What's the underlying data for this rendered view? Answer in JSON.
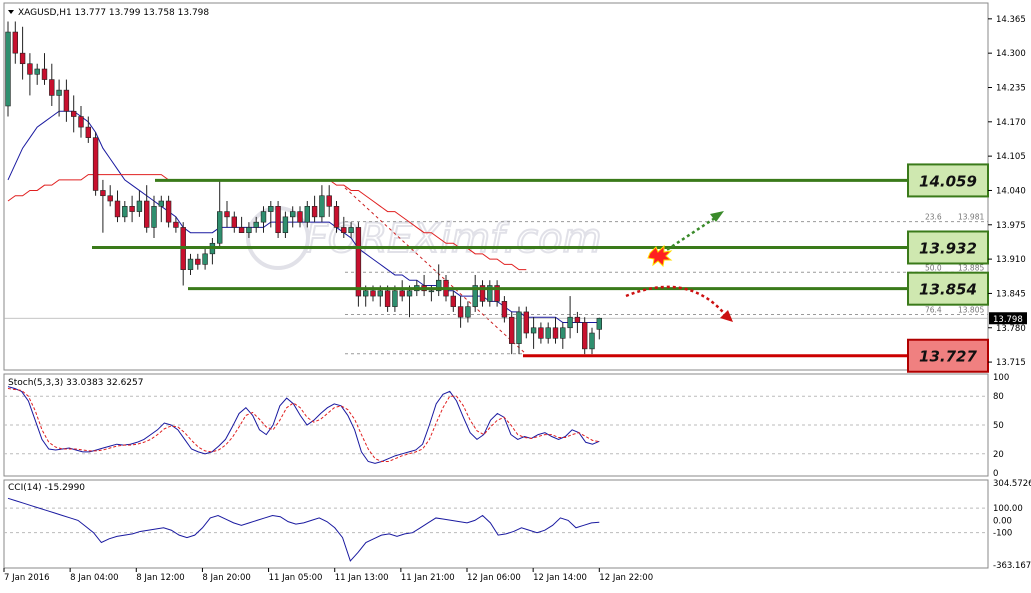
{
  "main": {
    "title": "XAGUSD,H1  13.777 13.799 13.758 13.798",
    "price_ticks": [
      "14.365",
      "14.300",
      "14.235",
      "14.170",
      "14.105",
      "14.040",
      "13.975",
      "13.910",
      "13.845",
      "13.780",
      "13.715"
    ],
    "current_price": "13.798",
    "fib_labels": [
      {
        "value": 13.981,
        "left": "23.6",
        "right": "13.981"
      },
      {
        "value": 13.885,
        "left": "50.0",
        "right": "13.885"
      },
      {
        "value": 13.805,
        "left": "76.4",
        "right": "13.805"
      }
    ],
    "levels": [
      {
        "value": 14.059,
        "label": "14.059",
        "kind": "resistance"
      },
      {
        "value": 13.932,
        "label": "13.932",
        "kind": "resistance"
      },
      {
        "value": 13.854,
        "label": "13.854",
        "kind": "resistance"
      },
      {
        "value": 13.727,
        "label": "13.727",
        "kind": "support"
      }
    ],
    "watermark": "FOREXimf.com"
  },
  "stoch": {
    "title": "Stoch(5,3,3) 33.0383 32.6257",
    "ticks": [
      "100",
      "80",
      "50",
      "20",
      "0"
    ]
  },
  "cci": {
    "title": "CCI(14) -15.2990",
    "ticks": [
      "304.5726",
      "100.00",
      "0.00",
      "-100",
      "-363.167"
    ]
  },
  "time_labels": [
    "7 Jan 2016",
    "8 Jan 04:00",
    "8 Jan 12:00",
    "8 Jan 20:00",
    "11 Jan 05:00",
    "11 Jan 13:00",
    "11 Jan 21:00",
    "12 Jan 06:00",
    "12 Jan 14:00",
    "12 Jan 22:00"
  ],
  "colors": {
    "up_candle": "#2f8f6f",
    "down_candle": "#c8102e",
    "ma_fast": "#1a1aa0",
    "ma_slow": "#e02020",
    "level_line": "#3a7a1a",
    "support_line": "#cc0000",
    "level_box_bg": "#cfe8b0",
    "support_box_bg": "#f08080"
  },
  "chart_data": [
    {
      "type": "candlestick",
      "title": "XAGUSD,H1  13.777 13.799 13.758 13.798",
      "ylim": [
        13.7,
        14.395
      ],
      "candles": [
        [
          14.2,
          14.36,
          14.18,
          14.34
        ],
        [
          14.34,
          14.36,
          14.28,
          14.3
        ],
        [
          14.3,
          14.35,
          14.25,
          14.28
        ],
        [
          14.28,
          14.3,
          14.22,
          14.26
        ],
        [
          14.26,
          14.28,
          14.24,
          14.27
        ],
        [
          14.27,
          14.3,
          14.24,
          14.25
        ],
        [
          14.25,
          14.28,
          14.2,
          14.22
        ],
        [
          14.22,
          14.25,
          14.18,
          14.23
        ],
        [
          14.23,
          14.25,
          14.17,
          14.19
        ],
        [
          14.19,
          14.22,
          14.15,
          14.18
        ],
        [
          14.18,
          14.2,
          14.14,
          14.16
        ],
        [
          14.16,
          14.18,
          14.13,
          14.14
        ],
        [
          14.14,
          14.15,
          14.03,
          14.04
        ],
        [
          14.04,
          14.06,
          13.96,
          14.03
        ],
        [
          14.03,
          14.05,
          14.01,
          14.02
        ],
        [
          14.02,
          14.04,
          13.98,
          13.99
        ],
        [
          13.99,
          14.02,
          13.98,
          14.01
        ],
        [
          14.01,
          14.03,
          13.98,
          14.0
        ],
        [
          14.0,
          14.04,
          13.99,
          14.02
        ],
        [
          14.02,
          14.05,
          13.96,
          13.97
        ],
        [
          13.97,
          14.03,
          13.95,
          14.01
        ],
        [
          14.01,
          14.03,
          13.98,
          14.02
        ],
        [
          14.02,
          14.03,
          13.97,
          13.98
        ],
        [
          13.98,
          13.99,
          13.96,
          13.97
        ],
        [
          13.97,
          13.98,
          13.86,
          13.89
        ],
        [
          13.89,
          13.92,
          13.88,
          13.91
        ],
        [
          13.91,
          13.92,
          13.89,
          13.9
        ],
        [
          13.9,
          13.93,
          13.89,
          13.92
        ],
        [
          13.92,
          13.95,
          13.9,
          13.94
        ],
        [
          13.94,
          14.06,
          13.93,
          14.0
        ],
        [
          14.0,
          14.02,
          13.97,
          13.99
        ],
        [
          13.99,
          14.0,
          13.96,
          13.97
        ],
        [
          13.97,
          13.99,
          13.96,
          13.96
        ],
        [
          13.96,
          13.98,
          13.95,
          13.97
        ],
        [
          13.97,
          13.99,
          13.96,
          13.98
        ],
        [
          13.98,
          14.01,
          13.96,
          14.0
        ],
        [
          14.0,
          14.02,
          13.97,
          14.01
        ],
        [
          14.01,
          14.02,
          13.95,
          13.96
        ],
        [
          13.96,
          14.0,
          13.95,
          13.99
        ],
        [
          13.99,
          14.01,
          13.97,
          14.0
        ],
        [
          14.0,
          14.01,
          13.97,
          13.98
        ],
        [
          13.98,
          14.02,
          13.97,
          14.01
        ],
        [
          14.01,
          14.03,
          13.98,
          13.99
        ],
        [
          13.99,
          14.05,
          13.98,
          14.03
        ],
        [
          14.03,
          14.05,
          13.99,
          14.01
        ],
        [
          14.01,
          14.02,
          13.96,
          13.97
        ],
        [
          13.97,
          13.99,
          13.95,
          13.96
        ],
        [
          13.96,
          13.98,
          13.95,
          13.97
        ],
        [
          13.97,
          13.98,
          13.82,
          13.84
        ],
        [
          13.84,
          13.86,
          13.82,
          13.85
        ],
        [
          13.85,
          13.86,
          13.83,
          13.84
        ],
        [
          13.84,
          13.86,
          13.82,
          13.85
        ],
        [
          13.85,
          13.86,
          13.81,
          13.82
        ],
        [
          13.82,
          13.86,
          13.81,
          13.85
        ],
        [
          13.85,
          13.87,
          13.83,
          13.84
        ],
        [
          13.84,
          13.86,
          13.8,
          13.85
        ],
        [
          13.85,
          13.87,
          13.84,
          13.86
        ],
        [
          13.86,
          13.88,
          13.84,
          13.85
        ],
        [
          13.85,
          13.86,
          13.83,
          13.85
        ],
        [
          13.85,
          13.9,
          13.84,
          13.87
        ],
        [
          13.87,
          13.88,
          13.83,
          13.84
        ],
        [
          13.84,
          13.85,
          13.81,
          13.82
        ],
        [
          13.82,
          13.84,
          13.78,
          13.8
        ],
        [
          13.8,
          13.83,
          13.79,
          13.82
        ],
        [
          13.82,
          13.88,
          13.81,
          13.86
        ],
        [
          13.86,
          13.87,
          13.82,
          13.83
        ],
        [
          13.83,
          13.87,
          13.82,
          13.86
        ],
        [
          13.86,
          13.87,
          13.82,
          13.83
        ],
        [
          13.83,
          13.84,
          13.79,
          13.8
        ],
        [
          13.8,
          13.81,
          13.73,
          13.75
        ],
        [
          13.75,
          13.82,
          13.73,
          13.81
        ],
        [
          13.81,
          13.82,
          13.76,
          13.77
        ],
        [
          13.77,
          13.8,
          13.74,
          13.78
        ],
        [
          13.78,
          13.79,
          13.75,
          13.76
        ],
        [
          13.76,
          13.79,
          13.75,
          13.78
        ],
        [
          13.78,
          13.8,
          13.75,
          13.76
        ],
        [
          13.76,
          13.79,
          13.74,
          13.78
        ],
        [
          13.78,
          13.84,
          13.76,
          13.8
        ],
        [
          13.8,
          13.81,
          13.77,
          13.79
        ],
        [
          13.79,
          13.8,
          13.73,
          13.74
        ],
        [
          13.74,
          13.78,
          13.73,
          13.77
        ],
        [
          13.777,
          13.799,
          13.758,
          13.798
        ]
      ],
      "ma_fast": [
        14.06,
        14.09,
        14.12,
        14.14,
        14.16,
        14.17,
        14.18,
        14.19,
        14.19,
        14.19,
        14.18,
        14.17,
        14.15,
        14.12,
        14.1,
        14.08,
        14.06,
        14.05,
        14.04,
        14.03,
        14.02,
        14.01,
        14.0,
        13.99,
        13.97,
        13.96,
        13.96,
        13.96,
        13.96,
        13.97,
        13.97,
        13.97,
        13.97,
        13.97,
        13.97,
        13.97,
        13.98,
        13.98,
        13.98,
        13.98,
        13.98,
        13.98,
        13.98,
        13.98,
        13.98,
        13.97,
        13.96,
        13.95,
        13.93,
        13.92,
        13.91,
        13.9,
        13.89,
        13.88,
        13.88,
        13.87,
        13.87,
        13.86,
        13.86,
        13.86,
        13.85,
        13.85,
        13.84,
        13.84,
        13.84,
        13.84,
        13.83,
        13.83,
        13.82,
        13.81,
        13.81,
        13.8,
        13.8,
        13.8,
        13.8,
        13.8,
        13.79,
        13.79,
        13.79,
        13.79,
        13.79,
        13.79
      ],
      "ma_slow": [
        14.02,
        14.03,
        14.03,
        14.04,
        14.04,
        14.05,
        14.05,
        14.06,
        14.06,
        14.06,
        14.06,
        14.07,
        14.07,
        14.07,
        14.07,
        14.07,
        14.07,
        14.07,
        14.07,
        14.07,
        14.07,
        14.07,
        14.06,
        14.06,
        14.06,
        14.06,
        14.06,
        14.06,
        14.06,
        14.06,
        14.06,
        14.06,
        14.06,
        14.06,
        14.06,
        14.06,
        14.06,
        14.06,
        14.06,
        14.06,
        14.06,
        14.06,
        14.06,
        14.06,
        14.06,
        14.05,
        14.05,
        14.04,
        14.04,
        14.03,
        14.02,
        14.01,
        14.0,
        14.0,
        13.99,
        13.98,
        13.97,
        13.96,
        13.96,
        13.95,
        13.94,
        13.94,
        13.93,
        13.93,
        13.92,
        13.92,
        13.91,
        13.91,
        13.9,
        13.9,
        13.89,
        13.89
      ],
      "levels": [
        14.059,
        13.932,
        13.854,
        13.727
      ]
    },
    {
      "type": "line",
      "title": "Stoch(5,3,3) 33.0383 32.6257",
      "ylim": [
        0,
        100
      ],
      "series": [
        {
          "values": [
            90,
            88,
            85,
            75,
            55,
            35,
            25,
            24,
            25,
            26,
            24,
            22,
            22,
            24,
            26,
            28,
            30,
            29,
            30,
            32,
            35,
            40,
            45,
            52,
            50,
            45,
            35,
            25,
            22,
            20,
            22,
            28,
            35,
            48,
            62,
            68,
            60,
            45,
            40,
            50,
            70,
            78,
            72,
            60,
            50,
            55,
            62,
            68,
            72,
            70,
            60,
            45,
            22,
            12,
            10,
            12,
            15,
            18,
            20,
            22,
            24,
            30,
            50,
            72,
            82,
            85,
            75,
            58,
            42,
            35,
            40,
            55,
            62,
            58,
            40,
            35,
            38,
            36,
            40,
            42,
            38,
            35,
            38,
            45,
            42,
            32,
            30,
            33
          ]
        },
        {
          "values": [
            88,
            87,
            86,
            80,
            65,
            45,
            32,
            27,
            25,
            25,
            25,
            24,
            23,
            23,
            24,
            26,
            28,
            29,
            29,
            30,
            32,
            35,
            40,
            46,
            49,
            48,
            42,
            34,
            27,
            23,
            22,
            24,
            29,
            37,
            48,
            60,
            63,
            56,
            48,
            45,
            55,
            68,
            73,
            68,
            58,
            53,
            56,
            62,
            68,
            70,
            66,
            56,
            40,
            25,
            15,
            12,
            12,
            15,
            18,
            20,
            22,
            25,
            35,
            52,
            68,
            80,
            80,
            70,
            55,
            44,
            40,
            48,
            55,
            58,
            50,
            40,
            37,
            36,
            38,
            40,
            40,
            37,
            37,
            40,
            42,
            38,
            34,
            32.6
          ]
        }
      ]
    },
    {
      "type": "line",
      "title": "CCI(14) -15.2990",
      "ylim": [
        -363.167,
        304.5726
      ],
      "series": [
        {
          "values": [
            180,
            160,
            140,
            120,
            100,
            80,
            60,
            40,
            20,
            0,
            -50,
            -100,
            -180,
            -150,
            -130,
            -120,
            -110,
            -90,
            -80,
            -70,
            -60,
            -80,
            -120,
            -140,
            -120,
            -60,
            20,
            40,
            10,
            -20,
            -40,
            -20,
            0,
            20,
            40,
            30,
            -10,
            -30,
            -20,
            0,
            20,
            -10,
            -60,
            -140,
            -330,
            -260,
            -180,
            -150,
            -120,
            -110,
            -130,
            -110,
            -100,
            -60,
            -20,
            20,
            10,
            0,
            -10,
            -20,
            0,
            40,
            -20,
            -120,
            -110,
            -90,
            -60,
            -80,
            -100,
            -80,
            -40,
            20,
            0,
            -60,
            -40,
            -20,
            -15.3
          ]
        }
      ]
    }
  ]
}
